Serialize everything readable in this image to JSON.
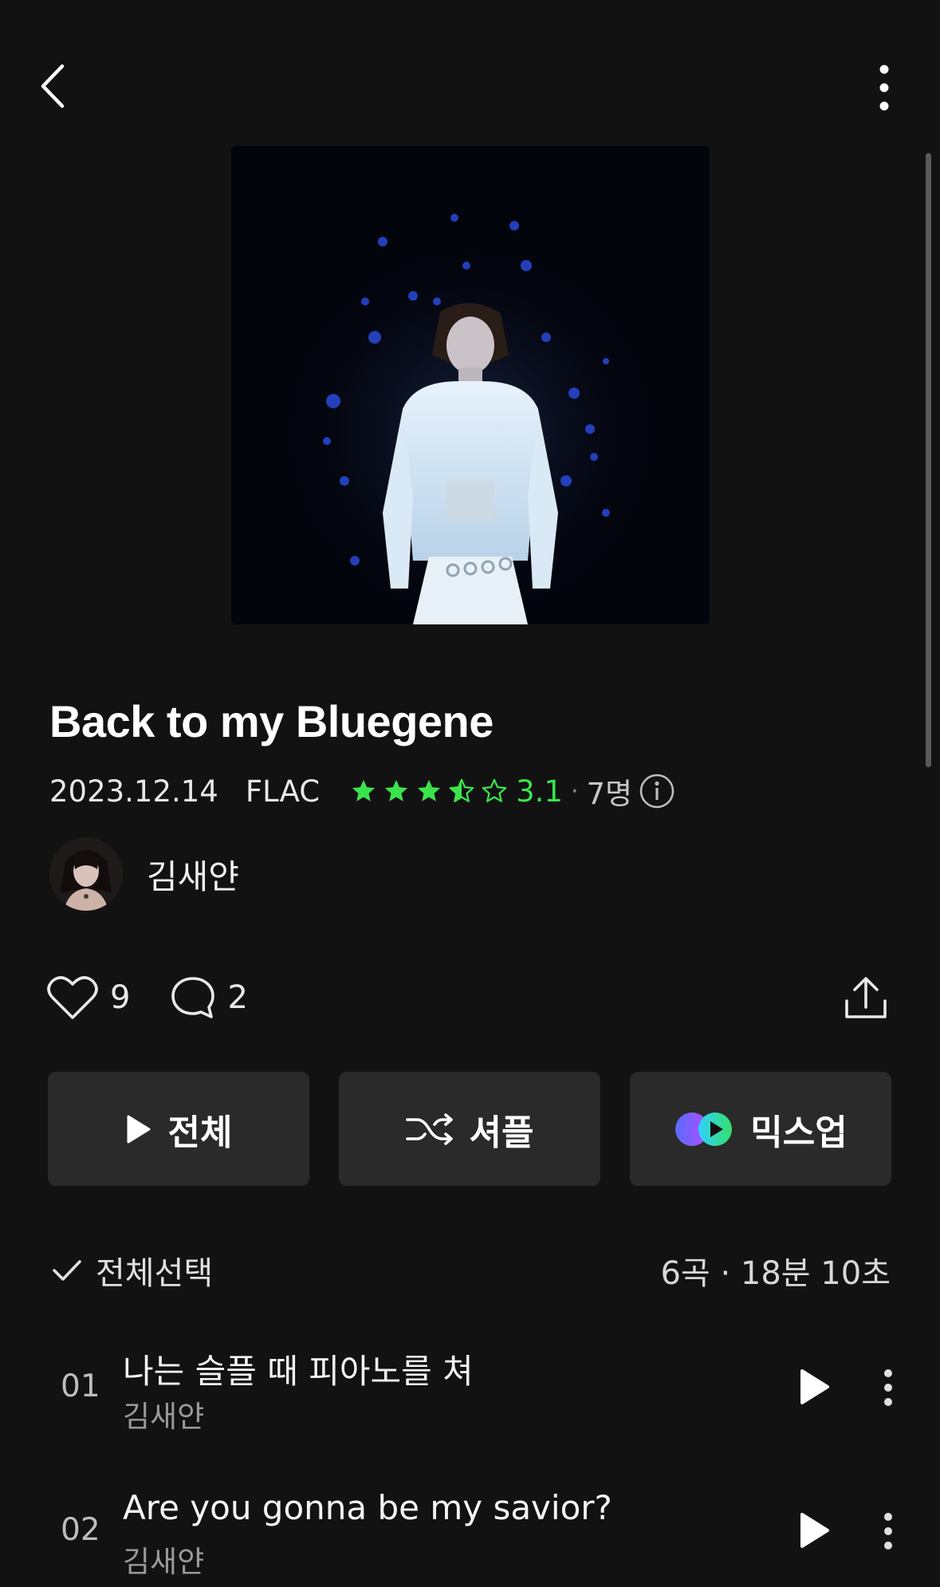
{
  "album": {
    "title": "Back to my Bluegene",
    "release_date": "2023.12.14",
    "format": "FLAC",
    "rating": "3.1",
    "rating_value": 3.5,
    "rating_count": "7명",
    "artist": "김새얀"
  },
  "social": {
    "likes": "9",
    "comments": "2"
  },
  "actions": {
    "play_all": "전체",
    "shuffle": "셔플",
    "mixup": "믹스업"
  },
  "list": {
    "select_all": "전체선택",
    "summary": "6곡 · 18분 10초"
  },
  "tracks": [
    {
      "number": "01",
      "title": "나는 슬플 때 피아노를 쳐",
      "artist": "김새얀"
    },
    {
      "number": "02",
      "title": "Are you gonna be my savior?",
      "artist": "김새얀"
    }
  ],
  "colors": {
    "background": "#121212",
    "accent_green": "#3be44c",
    "button_bg": "#2a2a2a"
  }
}
